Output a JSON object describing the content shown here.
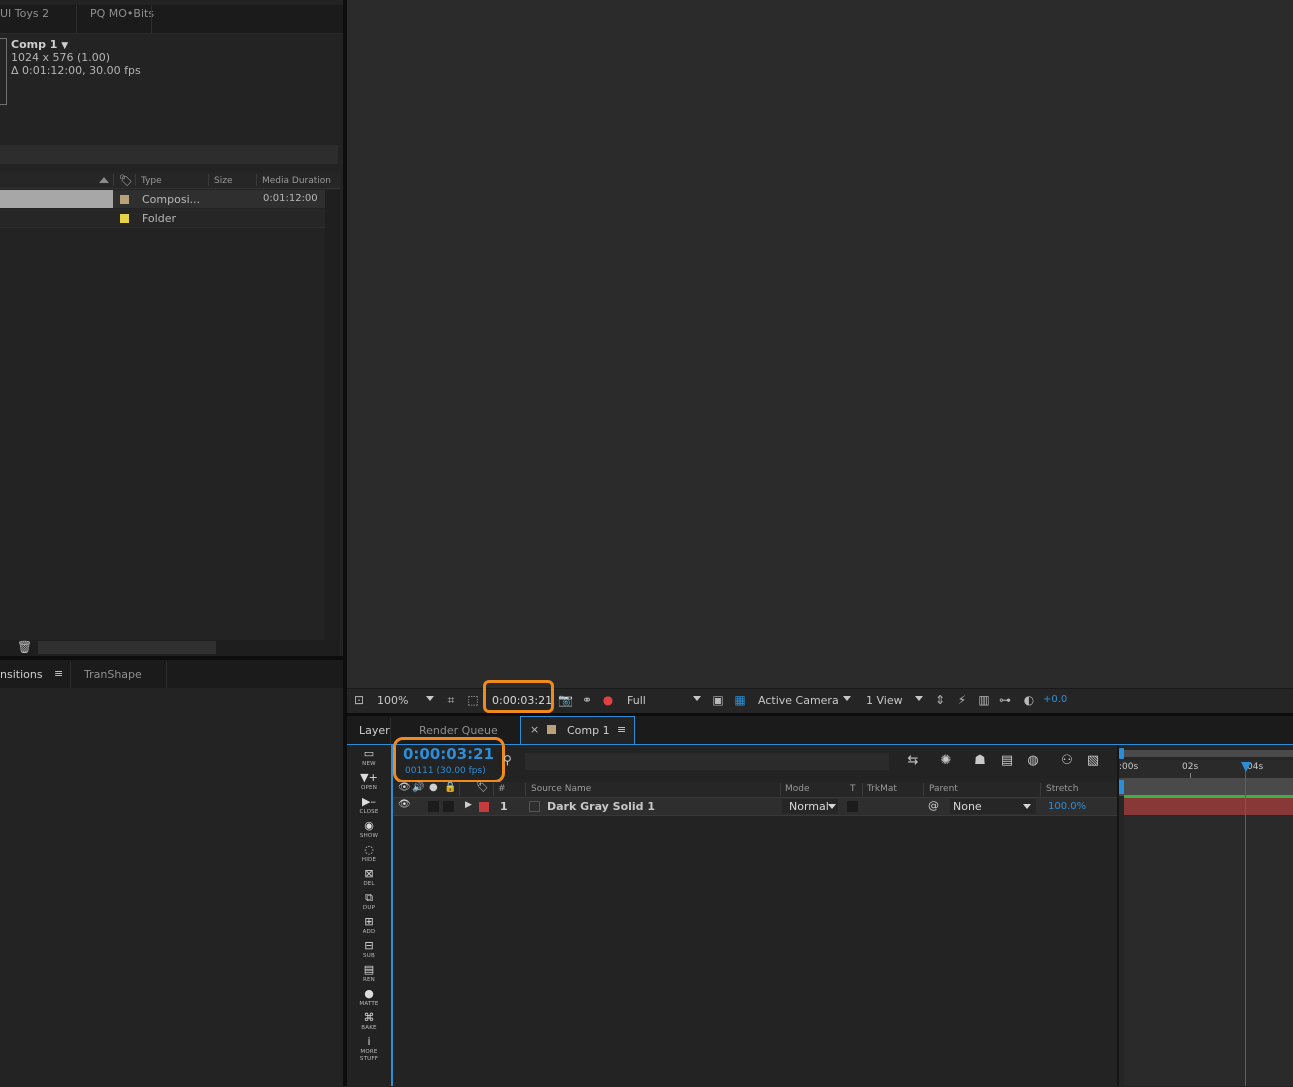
{
  "project_panel": {
    "tabs": [
      "UI Toys 2",
      "PQ MO•Bits"
    ],
    "comp_name": "Comp 1",
    "comp_size": "1024 x 576 (1.00)",
    "comp_duration": "Δ 0:01:12:00, 30.00 fps",
    "columns": [
      "Type",
      "Size",
      "Media Duration"
    ],
    "items": [
      {
        "type": "Composi...",
        "duration": "0:01:12:00",
        "swatch": "#b8a27a"
      },
      {
        "type": "Folder",
        "duration": "",
        "swatch": "#e3d24a"
      }
    ]
  },
  "effects_panel": {
    "tabs": [
      "nsitions",
      "TranShape"
    ]
  },
  "viewer_bar": {
    "zoom": "100%",
    "timecode": "0:00:03:21",
    "resolution": "Full",
    "camera": "Active Camera",
    "views": "1 View",
    "exposure": "+0.0"
  },
  "timeline": {
    "tabs": [
      "Layer",
      "Render Queue",
      "Comp 1"
    ],
    "timecode": "0:00:03:21",
    "frame_info": "00111 (30.00 fps)",
    "columns": {
      "hash": "#",
      "source_name": "Source Name",
      "mode": "Mode",
      "t": "T",
      "trkmat": "TrkMat",
      "parent": "Parent",
      "stretch": "Stretch"
    },
    "layer": {
      "index": "1",
      "name": "Dark Gray Solid 1",
      "mode": "Normal",
      "parent": "None",
      "stretch": "100.0%",
      "color": "#c43c3c"
    },
    "ruler_labels": [
      ":00s",
      "02s",
      "04s"
    ],
    "current_time_seconds": 3.7
  },
  "toolbar": {
    "labels": [
      "NEW",
      "OPEN",
      "CLOSE",
      "SHOW",
      "HIDE",
      "DEL",
      "DUP",
      "ADD",
      "SUB",
      "REN",
      "MATTE",
      "BAKE",
      "MORE STUFF"
    ]
  },
  "colors": {
    "accent": "#2c8ed8",
    "annotation": "#f08a1c",
    "layer_bar": "#a33d3d",
    "work_area": "#3cb043"
  }
}
